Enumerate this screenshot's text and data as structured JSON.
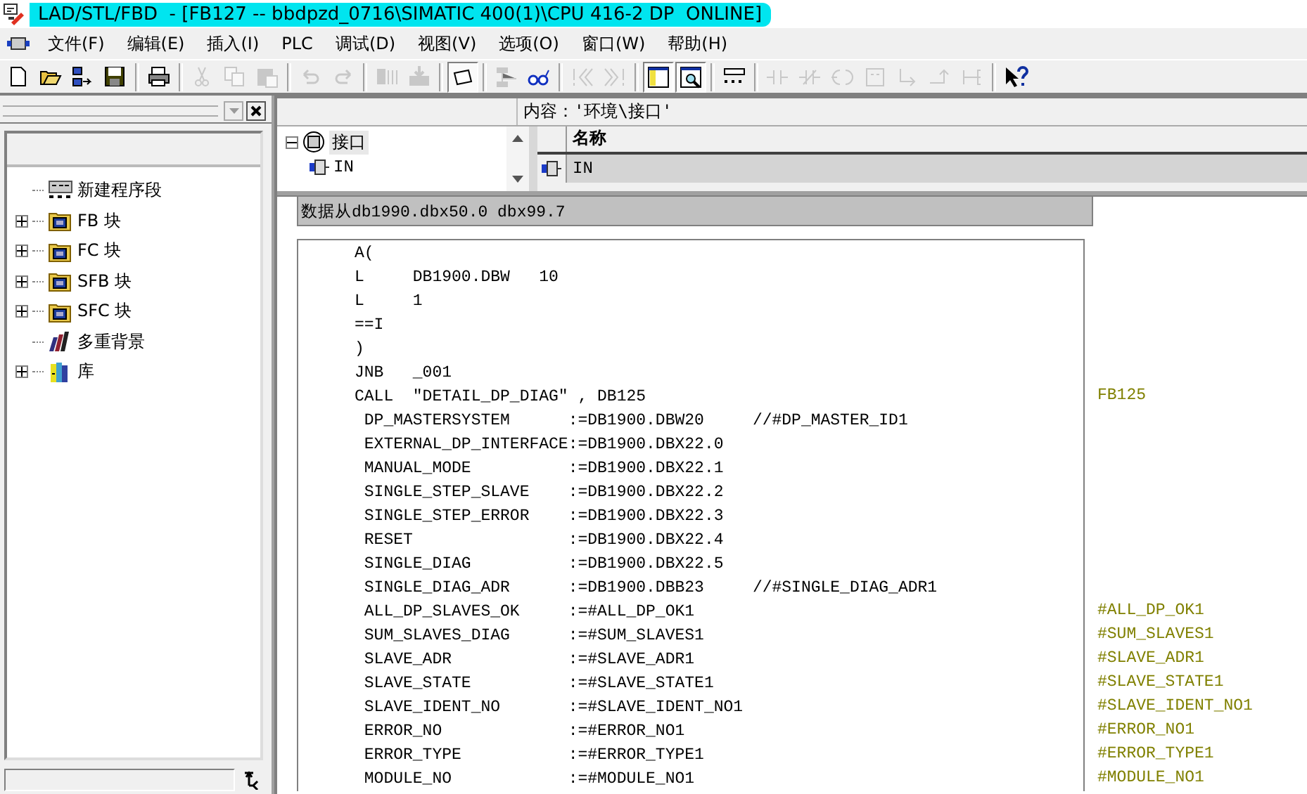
{
  "window": {
    "title": "LAD/STL/FBD  - [FB127 -- bbdpzd_0716\\SIMATIC 400(1)\\CPU 416-2 DP  ONLINE]"
  },
  "menu": [
    "文件(F)",
    "编辑(E)",
    "插入(I)",
    "PLC",
    "调试(D)",
    "视图(V)",
    "选项(O)",
    "窗口(W)",
    "帮助(H)"
  ],
  "toolbar": [
    {
      "kind": "new",
      "disabled": false,
      "pressed": false
    },
    {
      "kind": "open",
      "disabled": false,
      "pressed": false
    },
    {
      "kind": "nodes",
      "disabled": false,
      "pressed": false
    },
    {
      "kind": "save",
      "disabled": false,
      "pressed": false
    },
    {
      "kind": "sep"
    },
    {
      "kind": "print",
      "disabled": false,
      "pressed": false
    },
    {
      "kind": "sep"
    },
    {
      "kind": "cut",
      "disabled": true,
      "pressed": false
    },
    {
      "kind": "copy",
      "disabled": true,
      "pressed": false
    },
    {
      "kind": "paste",
      "disabled": true,
      "pressed": false
    },
    {
      "kind": "sep"
    },
    {
      "kind": "undo",
      "disabled": true,
      "pressed": false
    },
    {
      "kind": "redo",
      "disabled": true,
      "pressed": false
    },
    {
      "kind": "sep"
    },
    {
      "kind": "compile",
      "disabled": true,
      "pressed": false
    },
    {
      "kind": "download",
      "disabled": true,
      "pressed": false
    },
    {
      "kind": "sep"
    },
    {
      "kind": "monitor",
      "disabled": false,
      "pressed": true
    },
    {
      "kind": "sep"
    },
    {
      "kind": "network",
      "disabled": true,
      "pressed": false
    },
    {
      "kind": "glasses",
      "disabled": false,
      "pressed": false
    },
    {
      "kind": "sep"
    },
    {
      "kind": "prev",
      "disabled": true,
      "pressed": false
    },
    {
      "kind": "next",
      "disabled": true,
      "pressed": false
    },
    {
      "kind": "sep"
    },
    {
      "kind": "overview",
      "disabled": false,
      "pressed": true
    },
    {
      "kind": "details",
      "disabled": false,
      "pressed": true
    },
    {
      "kind": "sep"
    },
    {
      "kind": "segment",
      "disabled": false,
      "pressed": false
    },
    {
      "kind": "sep"
    },
    {
      "kind": "contact",
      "disabled": true,
      "pressed": false
    },
    {
      "kind": "ncontact",
      "disabled": true,
      "pressed": false
    },
    {
      "kind": "coil",
      "disabled": true,
      "pressed": false
    },
    {
      "kind": "box",
      "disabled": true,
      "pressed": false
    },
    {
      "kind": "branch",
      "disabled": true,
      "pressed": false
    },
    {
      "kind": "close",
      "disabled": true,
      "pressed": false
    },
    {
      "kind": "conn",
      "disabled": true,
      "pressed": false
    },
    {
      "kind": "sep"
    },
    {
      "kind": "help",
      "disabled": false,
      "pressed": false
    }
  ],
  "program_elements": [
    {
      "label": "新建程序段",
      "kind": "network",
      "expandable": false
    },
    {
      "label": "FB 块",
      "kind": "block",
      "expandable": true
    },
    {
      "label": "FC 块",
      "kind": "block",
      "expandable": true
    },
    {
      "label": "SFB 块",
      "kind": "block",
      "expandable": true
    },
    {
      "label": "SFC 块",
      "kind": "block",
      "expandable": true
    },
    {
      "label": "多重背景",
      "kind": "multi",
      "expandable": false
    },
    {
      "label": "库",
      "kind": "library",
      "expandable": true
    }
  ],
  "interface": {
    "content_label": "内容：'环境\\接口'",
    "tree": {
      "label": "接口",
      "expanded": true,
      "children": [
        {
          "label": "IN"
        }
      ]
    },
    "columns": [
      "名称"
    ],
    "rows": [
      {
        "name": "IN",
        "selected": true
      }
    ]
  },
  "network_comment": "数据从db1990.dbx50.0 dbx99.7",
  "code_lines": [
    {
      "text": "A("
    },
    {
      "text": "L     DB1900.DBW   10"
    },
    {
      "text": "L     1"
    },
    {
      "text": "==I"
    },
    {
      "text": ")"
    },
    {
      "text": "JNB   _001"
    },
    {
      "text": "CALL  ″DETAIL_DP_DIAG″ , DB125",
      "annotation": "FB125"
    },
    {
      "text": " DP_MASTERSYSTEM      :=DB1900.DBW20     //#DP_MASTER_ID1"
    },
    {
      "text": " EXTERNAL_DP_INTERFACE:=DB1900.DBX22.0"
    },
    {
      "text": " MANUAL_MODE          :=DB1900.DBX22.1"
    },
    {
      "text": " SINGLE_STEP_SLAVE    :=DB1900.DBX22.2"
    },
    {
      "text": " SINGLE_STEP_ERROR    :=DB1900.DBX22.3"
    },
    {
      "text": " RESET                :=DB1900.DBX22.4"
    },
    {
      "text": " SINGLE_DIAG          :=DB1900.DBX22.5"
    },
    {
      "text": " SINGLE_DIAG_ADR      :=DB1900.DBB23     //#SINGLE_DIAG_ADR1"
    },
    {
      "text": " ALL_DP_SLAVES_OK     :=#ALL_DP_OK1",
      "annotation": "#ALL_DP_OK1"
    },
    {
      "text": " SUM_SLAVES_DIAG      :=#SUM_SLAVES1",
      "annotation": "#SUM_SLAVES1"
    },
    {
      "text": " SLAVE_ADR            :=#SLAVE_ADR1",
      "annotation": "#SLAVE_ADR1"
    },
    {
      "text": " SLAVE_STATE          :=#SLAVE_STATE1",
      "annotation": "#SLAVE_STATE1"
    },
    {
      "text": " SLAVE_IDENT_NO       :=#SLAVE_IDENT_NO1",
      "annotation": "#SLAVE_IDENT_NO1"
    },
    {
      "text": " ERROR_NO             :=#ERROR_NO1",
      "annotation": "#ERROR_NO1"
    },
    {
      "text": " ERROR_TYPE           :=#ERROR_TYPE1",
      "annotation": "#ERROR_TYPE1"
    },
    {
      "text": " MODULE_NO            :=#MODULE_NO1",
      "annotation": "#MODULE_NO1"
    }
  ]
}
